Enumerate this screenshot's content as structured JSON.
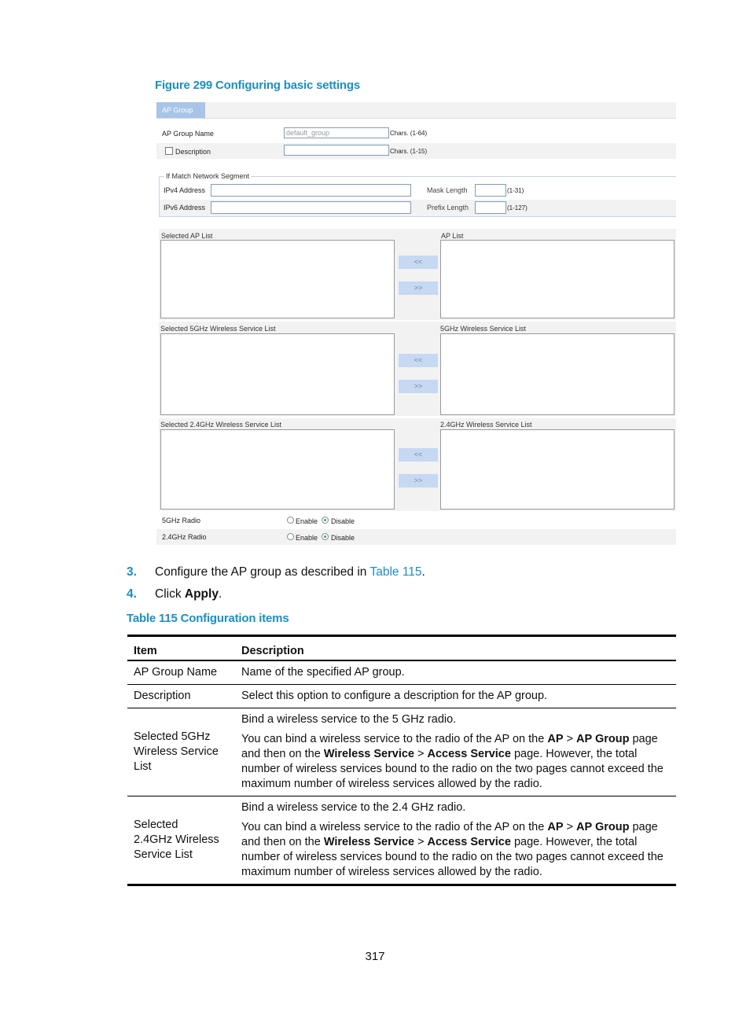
{
  "figure_caption": "Figure 299 Configuring basic settings",
  "ui": {
    "tab": "AP Group",
    "ap_group_name": {
      "label": "AP Group Name",
      "value": "default_group",
      "hint": "Chars. (1-64)"
    },
    "description": {
      "label": "Description",
      "value": "",
      "hint": "Chars. (1-15)",
      "checked": false
    },
    "network_segment": {
      "legend": "If Match Network Segment",
      "ipv4_label": "IPv4 Address",
      "ipv4_value": "",
      "mask_label": "Mask Length",
      "mask_value": "",
      "mask_hint": "(1-31)",
      "ipv6_label": "IPv6 Address",
      "ipv6_value": "",
      "prefix_label": "Prefix Length",
      "prefix_value": "",
      "prefix_hint": "(1-127)"
    },
    "lists": [
      {
        "selected_label": "Selected AP List",
        "available_label": "AP List",
        "add_button": "<<",
        "remove_button": ">>"
      },
      {
        "selected_label": "Selected 5GHz Wireless Service List",
        "available_label": "5GHz Wireless Service List",
        "add_button": "<<",
        "remove_button": ">>"
      },
      {
        "selected_label": "Selected 2.4GHz Wireless Service List",
        "available_label": "2.4GHz Wireless Service List",
        "add_button": "<<",
        "remove_button": ">>"
      }
    ],
    "radios": [
      {
        "label": "5GHz Radio",
        "enable": "Enable",
        "disable": "Disable",
        "selected": "Disable"
      },
      {
        "label": "2.4GHz Radio",
        "enable": "Enable",
        "disable": "Disable",
        "selected": "Disable"
      }
    ]
  },
  "steps": [
    {
      "num": "3.",
      "pre": "Configure the AP group as described in ",
      "link": "Table 115",
      "post": "."
    },
    {
      "num": "4.",
      "pre": "Click ",
      "bold": "Apply",
      "post": "."
    }
  ],
  "table_caption": "Table 115 Configuration items",
  "table": {
    "headers": [
      "Item",
      "Description"
    ],
    "rows": [
      {
        "item": "AP Group Name",
        "desc": [
          "Name of the specified AP group."
        ]
      },
      {
        "item": "Description",
        "desc": [
          "Select this option to configure a description for the AP group."
        ]
      },
      {
        "item": "Selected 5GHz Wireless Service List",
        "desc1": "Bind a wireless service to the 5 GHz radio.",
        "p2": {
          "a": "You can bind a wireless service to the radio of the AP on the ",
          "b1": "AP",
          "c": " > ",
          "b2": "AP Group",
          "d": " page and then on the ",
          "b3": "Wireless Service",
          "e": " > ",
          "b4": "Access Service",
          "f": " page. However, the total number of wireless services bound to the radio on the two pages cannot exceed the maximum number of wireless services allowed by the radio."
        }
      },
      {
        "item": "Selected 2.4GHz Wireless Service List",
        "desc1": "Bind a wireless service to the 2.4 GHz radio.",
        "p2": {
          "a": "You can bind a wireless service to the radio of the AP on the ",
          "b1": "AP",
          "c": " > ",
          "b2": "AP Group",
          "d": " page and then on the ",
          "b3": "Wireless Service",
          "e": " > ",
          "b4": "Access Service",
          "f": " page. However, the total number of wireless services bound to the radio on the two pages cannot exceed the maximum number of wireless services allowed by the radio."
        }
      }
    ]
  },
  "page_number": "317"
}
